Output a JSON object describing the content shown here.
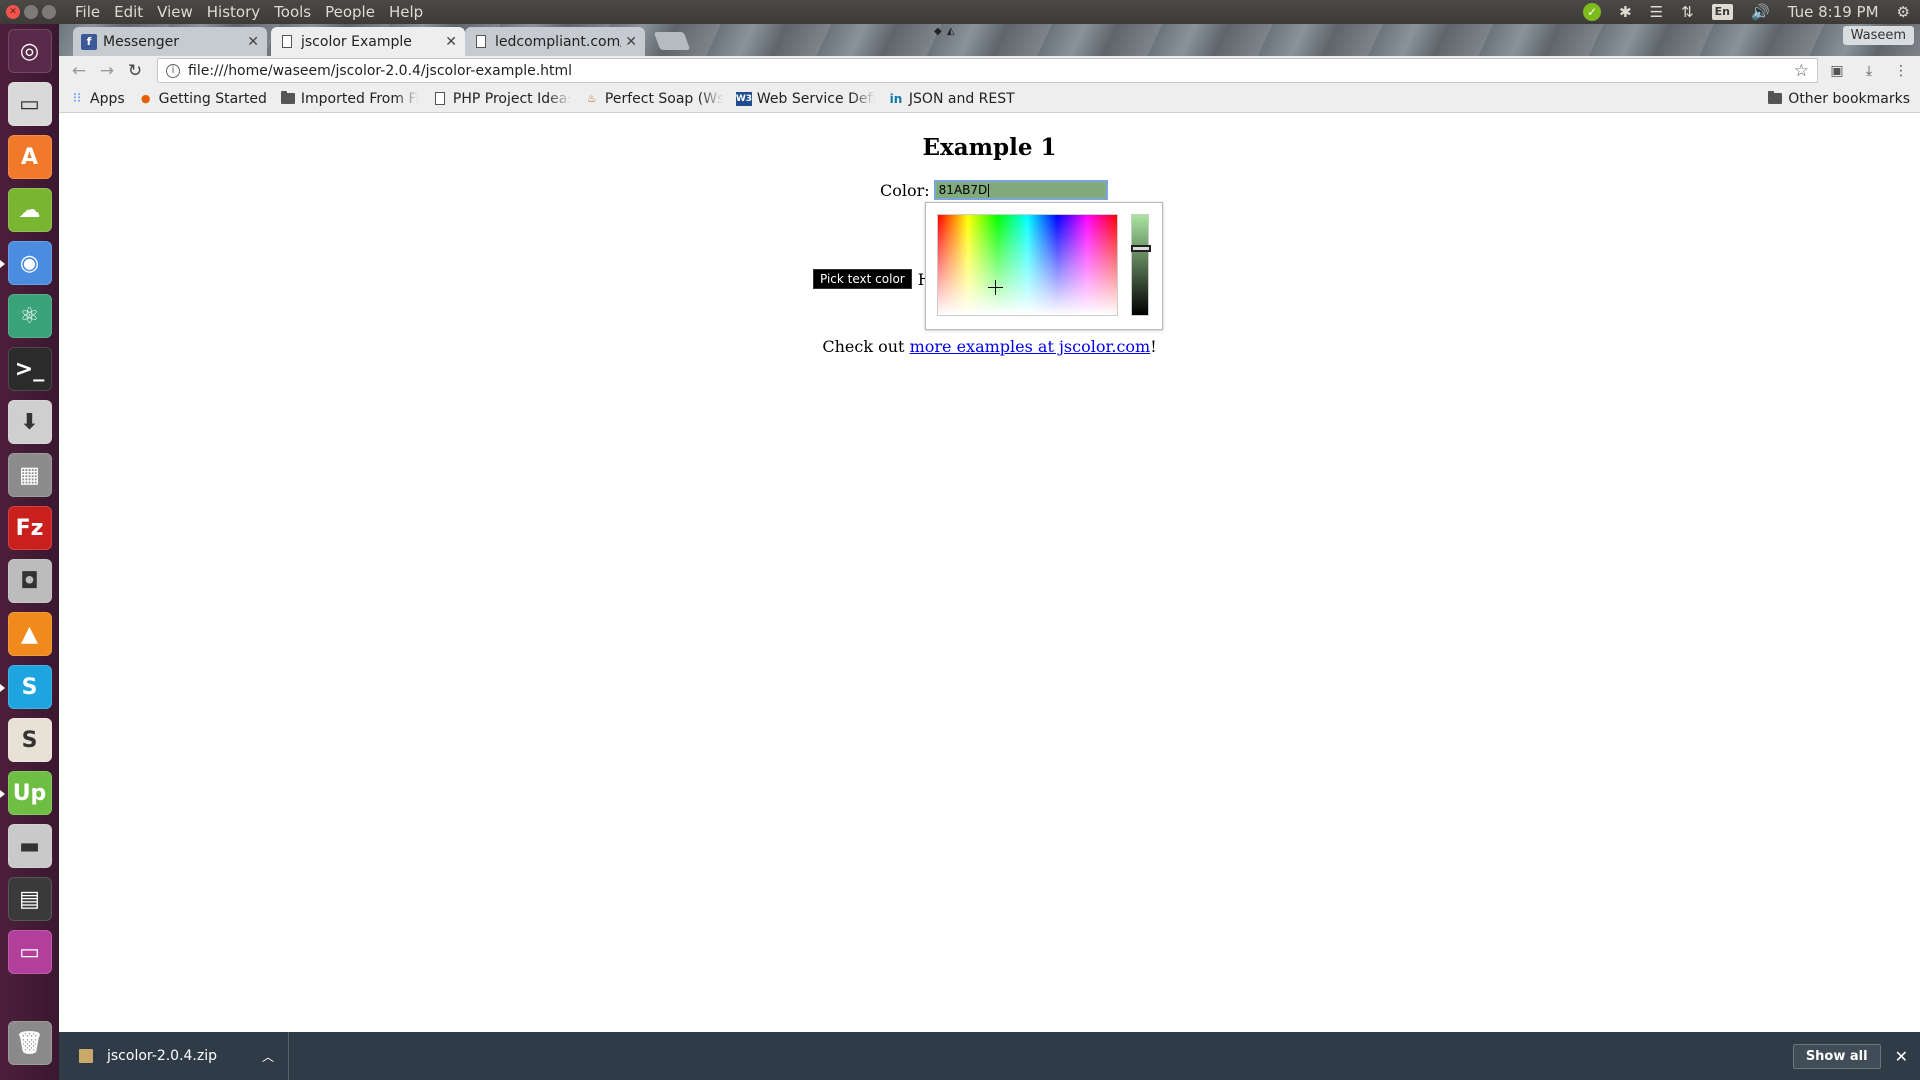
{
  "top_panel": {
    "menu": [
      "File",
      "Edit",
      "View",
      "History",
      "Tools",
      "People",
      "Help"
    ],
    "language": "En",
    "clock": "Tue 8:19 PM"
  },
  "launcher": {
    "items": [
      {
        "name": "ubuntu-dash-icon",
        "glyph": "◎",
        "color": "#5a2a4a"
      },
      {
        "name": "files-icon",
        "glyph": "▭",
        "color": "#d9d9d9"
      },
      {
        "name": "software-center-icon",
        "glyph": "A",
        "color": "#f07a2a"
      },
      {
        "name": "cloud-sync-icon",
        "glyph": "☁",
        "color": "#7ab531"
      },
      {
        "name": "chrome-icon",
        "glyph": "◉",
        "color": "#4a8de0"
      },
      {
        "name": "atom-icon",
        "glyph": "⚛",
        "color": "#3aa37a"
      },
      {
        "name": "terminal-icon",
        "glyph": ">_",
        "color": "#2b2b2b"
      },
      {
        "name": "installer-icon",
        "glyph": "⬇",
        "color": "#cfcfcf"
      },
      {
        "name": "calculator-icon",
        "glyph": "▦",
        "color": "#8c8c8c"
      },
      {
        "name": "filezilla-icon",
        "glyph": "Fz",
        "color": "#c9201e"
      },
      {
        "name": "screenshot-icon",
        "glyph": "◘",
        "color": "#bcbcbc"
      },
      {
        "name": "vlc-icon",
        "glyph": "▲",
        "color": "#f08a1d"
      },
      {
        "name": "skype-icon",
        "glyph": "S",
        "color": "#1ea5e0"
      },
      {
        "name": "slack-icon",
        "glyph": "S",
        "color": "#e8e1d5"
      },
      {
        "name": "upwork-icon",
        "glyph": "Up",
        "color": "#6fbe44"
      },
      {
        "name": "disk-icon",
        "glyph": "▬",
        "color": "#c9c9c9"
      },
      {
        "name": "workspace-switcher-icon",
        "glyph": "▤",
        "color": "#3a3a3a"
      },
      {
        "name": "window-icon",
        "glyph": "▭",
        "color": "#b23f9c"
      }
    ],
    "trash_glyph": "🗑"
  },
  "tabs": [
    {
      "title": "Messenger",
      "favicon": "f",
      "close": "✕"
    },
    {
      "title": "jscolor Example",
      "favicon": "",
      "close": "✕"
    },
    {
      "title": "ledcompliant.com/in",
      "favicon": "",
      "close": "✕"
    }
  ],
  "user_chip": "Waseem",
  "address_bar": {
    "url": "file:///home/waseem/jscolor-2.0.4/jscolor-example.html"
  },
  "bookmarks": [
    {
      "label": "Apps",
      "icon": "apps-grid-icon"
    },
    {
      "label": "Getting Started",
      "icon": "firefox-icon"
    },
    {
      "label": "Imported From Fir",
      "icon": "folder-icon"
    },
    {
      "label": "PHP Project Ideas",
      "icon": "page-icon"
    },
    {
      "label": "Perfect Soap (Wsd",
      "icon": "soap-icon"
    },
    {
      "label": "Web Service Defin",
      "icon": "w3-icon"
    },
    {
      "label": "JSON and REST",
      "icon": "linkedin-icon"
    }
  ],
  "other_bookmarks": "Other bookmarks",
  "page": {
    "heading": "Example 1",
    "color_label": "Color:",
    "color_value": "81AB7D",
    "pick_button": "Pick text color",
    "pick_trailing": "H",
    "more_prefix": "Check out ",
    "more_link": "more examples at jscolor.com",
    "more_suffix": "!"
  },
  "picker": {
    "hue_fraction": 0.32,
    "saturation_fraction": 0.28,
    "value_fraction": 0.67,
    "selected_color": "#81AB7D"
  },
  "download_shelf": {
    "filename": "jscolor-2.0.4.zip",
    "show_all": "Show all"
  }
}
